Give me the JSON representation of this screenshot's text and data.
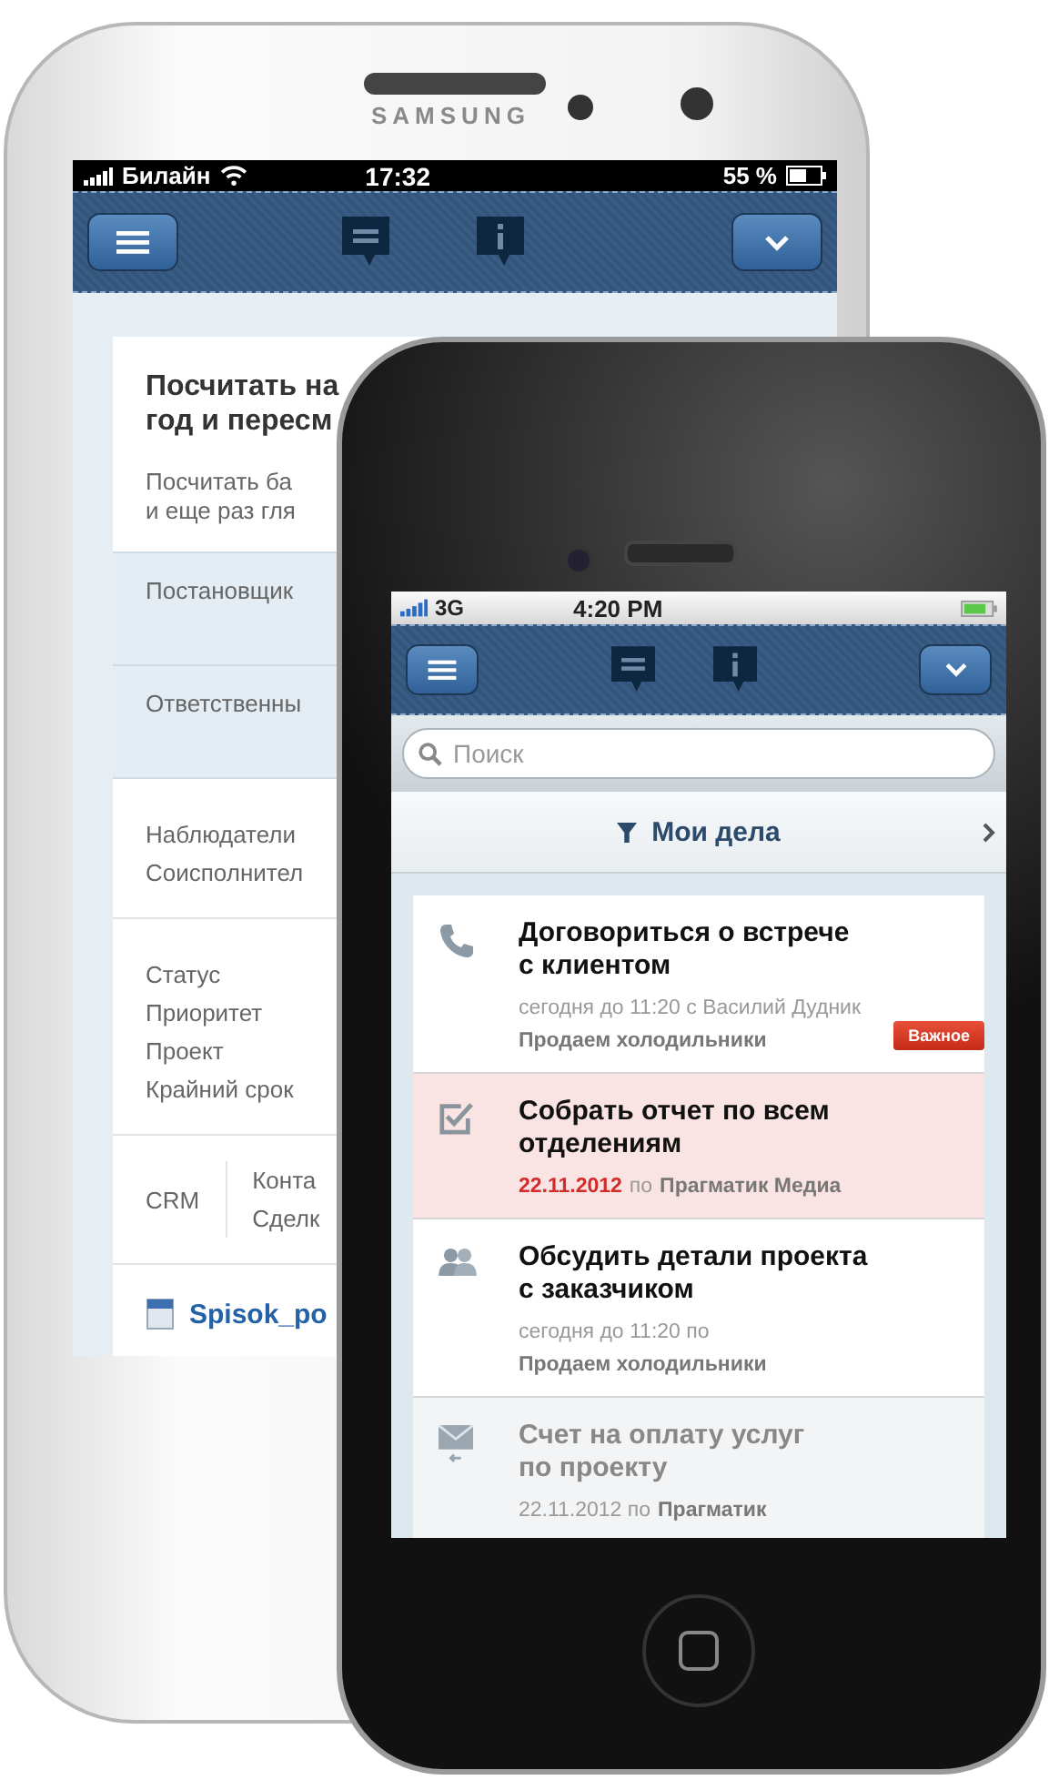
{
  "back_phone": {
    "brand": "SAMSUNG",
    "status_bar": {
      "carrier": "Билайн",
      "time": "17:32",
      "battery": "55 %"
    },
    "task": {
      "title": "Посчитать на\nгод и пересм",
      "description": "Посчитать ба\nи еще раз гля",
      "people": [
        "Постановщик",
        "Ответственны"
      ],
      "watchers": [
        "Наблюдатели",
        "Соисполнител"
      ],
      "fields": [
        "Статус",
        "Приоритет",
        "Проект",
        "Крайний срок"
      ],
      "crm": {
        "label": "CRM",
        "items": [
          "Конта",
          "Сделк"
        ]
      },
      "attachment": "Spisok_po"
    }
  },
  "front_phone": {
    "status_bar": {
      "network": "3G",
      "time": "4:20 PM"
    },
    "search": {
      "placeholder": "Поиск"
    },
    "filter": {
      "label": "Мои дела"
    },
    "tasks": [
      {
        "kind": "call",
        "title": "Договориться о встрече\nс клиентом",
        "meta": "сегодня до 11:20 с Василий Дудник",
        "project": "Продаем холодильники",
        "badge": "Важное",
        "highlighted": false,
        "dimmed": false
      },
      {
        "kind": "check",
        "title": "Собрать отчет по всем\nотделениям",
        "deadline": "22.11.2012",
        "meta": "по",
        "project": "Прагматик Медиа",
        "highlighted": true,
        "dimmed": false
      },
      {
        "kind": "people",
        "title": "Обсудить детали проекта\nс заказчиком",
        "meta": "сегодня до 11:20 по",
        "project": "Продаем холодильники",
        "highlighted": false,
        "dimmed": false
      },
      {
        "kind": "mail",
        "title": "Счет на оплату услуг\nпо проекту",
        "meta": "22.11.2012 по",
        "project": "Прагматик",
        "highlighted": false,
        "dimmed": true
      }
    ]
  }
}
